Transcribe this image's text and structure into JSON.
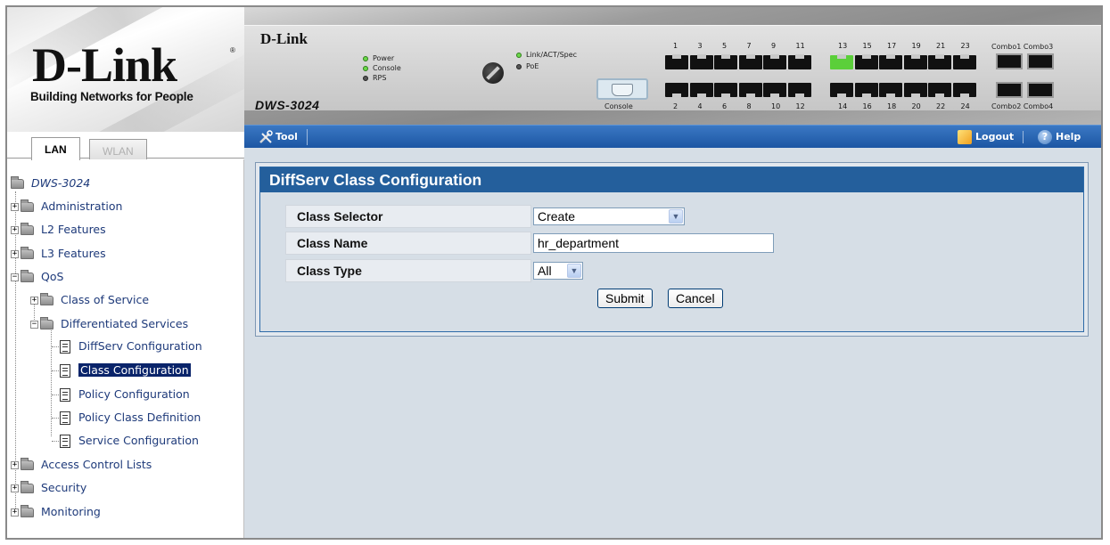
{
  "brand": {
    "logo": "D-Link",
    "tagline": "Building Networks for People"
  },
  "tabs": [
    {
      "label": "LAN",
      "active": true
    },
    {
      "label": "WLAN",
      "active": false
    }
  ],
  "device": {
    "brand": "D-Link",
    "model": "DWS-3024",
    "leds_left": [
      "Power",
      "Console",
      "RPS"
    ],
    "leds_right": [
      "Link/ACT/Spec",
      "PoE"
    ],
    "console_label": "Console",
    "top_port_numbers": [
      "1",
      "3",
      "5",
      "7",
      "9",
      "11",
      "13",
      "15",
      "17",
      "19",
      "21",
      "23"
    ],
    "bottom_port_numbers": [
      "2",
      "4",
      "6",
      "8",
      "10",
      "12",
      "14",
      "16",
      "18",
      "20",
      "22",
      "24"
    ],
    "combo_top": "Combo1 Combo3",
    "combo_bottom": "Combo2 Combo4"
  },
  "toolbar": {
    "tool": "Tool",
    "logout": "Logout",
    "help": "Help",
    "accent": "#245f9c"
  },
  "tree": {
    "root": "DWS-3024",
    "items": {
      "administration": "Administration",
      "l2": "L2 Features",
      "l3": "L3 Features",
      "qos": "QoS",
      "cos": "Class of Service",
      "diffserv": "Differentiated Services",
      "diffserv_config": "DiffServ Configuration",
      "class_config": "Class Configuration",
      "policy_config": "Policy Configuration",
      "policy_class_def": "Policy Class Definition",
      "service_config": "Service Configuration",
      "acl": "Access Control Lists",
      "security": "Security",
      "monitoring": "Monitoring"
    },
    "selected": "Class Configuration"
  },
  "form": {
    "title": "DiffServ Class Configuration",
    "class_selector": {
      "label": "Class Selector",
      "value": "Create"
    },
    "class_name": {
      "label": "Class Name",
      "value": "hr_department"
    },
    "class_type": {
      "label": "Class Type",
      "value": "All"
    },
    "submit": "Submit",
    "cancel": "Cancel"
  }
}
